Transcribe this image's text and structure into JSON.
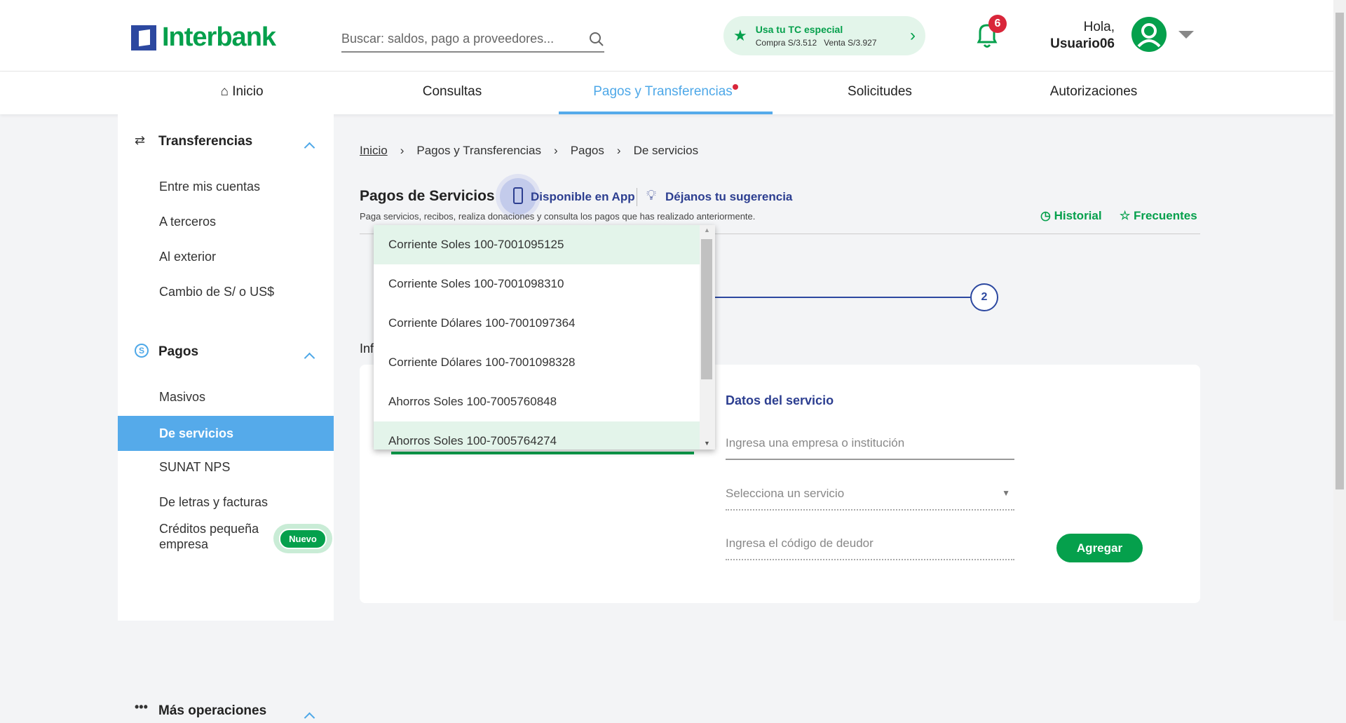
{
  "header": {
    "logo": "Interbank",
    "search_placeholder": "Buscar: saldos, pago a proveedores...",
    "tc": {
      "title": "Usa tu TC especial",
      "rates": "Compra S/3.512   Venta S/3.927"
    },
    "notifications": "6",
    "greeting": "Hola,",
    "user": "Usuario06"
  },
  "nav": [
    {
      "label": "Inicio"
    },
    {
      "label": "Consultas"
    },
    {
      "label": "Pagos y Transferencias",
      "active": true
    },
    {
      "label": "Solicitudes"
    },
    {
      "label": "Autorizaciones"
    }
  ],
  "sidebar": {
    "sections": [
      {
        "title": "Transferencias",
        "items": [
          "Entre mis cuentas",
          "A terceros",
          "Al exterior",
          "Cambio de S/ o US$"
        ]
      },
      {
        "title": "Pagos",
        "items": [
          "Masivos",
          "De servicios",
          "SUNAT NPS",
          "De letras y facturas",
          "Créditos pequeña empresa"
        ]
      },
      {
        "title": "Más operaciones"
      }
    ],
    "active": "De servicios",
    "badge": "Nuevo"
  },
  "breadcrumb": [
    "Inicio",
    "Pagos y Transferencias",
    "Pagos",
    "De servicios"
  ],
  "page": {
    "title": "Pagos de Servicios",
    "app": "Disponible en App",
    "suggest": "Déjanos tu sugerencia",
    "subtitle": "Paga servicios, recibos, realiza donaciones y consulta los pagos que has realizado anteriormente.",
    "historial": "Historial",
    "frecuentes": "Frecuentes",
    "step": "2",
    "section_partial": "Inf"
  },
  "dropdown": {
    "options": [
      "Corriente Soles 100-7001095125",
      "Corriente Soles 100-7001098310",
      "Corriente Dólares 100-7001097364",
      "Corriente Dólares 100-7001098328",
      "Ahorros Soles 100-7005760848",
      "Ahorros Soles 100-7005764274"
    ]
  },
  "service": {
    "title": "Datos del servicio",
    "empresa_placeholder": "Ingresa una empresa o institución",
    "servicio_placeholder": "Selecciona un servicio",
    "deudor_placeholder": "Ingresa el código de deudor",
    "add": "Agregar"
  },
  "colors": {
    "green": "#05a04c",
    "blue": "#55aaea",
    "navy": "#2c48a0"
  }
}
